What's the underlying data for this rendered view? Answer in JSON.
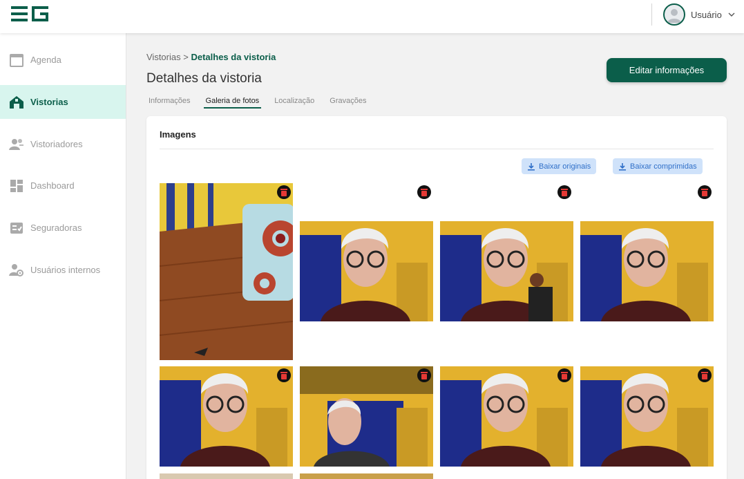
{
  "user": {
    "label": "Usuário"
  },
  "sidebar": {
    "items": [
      {
        "label": "Agenda",
        "icon": "calendar-icon"
      },
      {
        "label": "Vistorias",
        "icon": "house-icon"
      },
      {
        "label": "Vistoriadores",
        "icon": "people-icon"
      },
      {
        "label": "Dashboard",
        "icon": "dashboard-icon"
      },
      {
        "label": "Seguradoras",
        "icon": "checklist-icon"
      },
      {
        "label": "Usuários internos",
        "icon": "user-gear-icon"
      }
    ]
  },
  "breadcrumb": {
    "root": "Vistorias",
    "separator": ">",
    "current": "Detalhes da vistoria"
  },
  "page": {
    "title": "Detalhes da vistoria",
    "edit_label": "Editar informações"
  },
  "tabs": [
    "Informações",
    "Galeria de fotos",
    "Localização",
    "Gravações"
  ],
  "gallery": {
    "title": "Imagens",
    "download_originals": "Baixar originais",
    "download_compressed": "Baixar comprimidas"
  },
  "colors": {
    "brand": "#0b5e4a",
    "active_bg": "#d8f5ee",
    "download_bg": "#cfe2fa",
    "download_text": "#2f6fc8",
    "trash": "#e53935"
  }
}
